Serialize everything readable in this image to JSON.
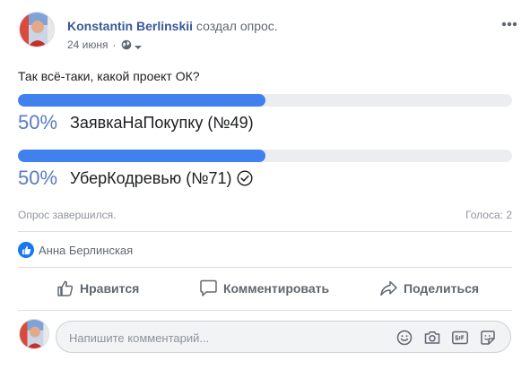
{
  "post": {
    "author_name": "Konstantin Berlinskii",
    "author_action": "создал опрос.",
    "date": "24 июня",
    "privacy_icon": "globe-icon",
    "menu_icon": "more-icon"
  },
  "poll": {
    "question": "Так всё-таки, какой проект ОК?",
    "options": [
      {
        "percent_text": "50%",
        "percent_value": 0.5,
        "label": "ЗаявкаНаПокупку (№49)",
        "voted": false
      },
      {
        "percent_text": "50%",
        "percent_value": 0.5,
        "label": "УберКодревью (№71)",
        "voted": true
      }
    ],
    "status": "Опрос завершился.",
    "votes": "Голоса: 2"
  },
  "reactions": {
    "icon": "like-icon",
    "liker": "Анна Берлинская"
  },
  "actions": {
    "like": "Нравится",
    "comment": "Комментировать",
    "share": "Поделиться"
  },
  "comment": {
    "placeholder": "Напишите комментарий...",
    "icons": [
      "emoji-icon",
      "camera-icon",
      "gif-icon",
      "sticker-icon"
    ]
  },
  "colors": {
    "accent": "#4080ef",
    "link": "#385898",
    "percent": "#5b7bbf",
    "like_badge": "#1877f2"
  }
}
